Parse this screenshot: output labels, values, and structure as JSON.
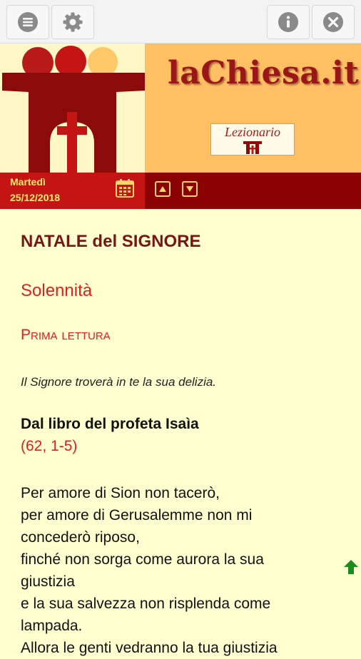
{
  "toolbar": {
    "left_icons": [
      "menu-icon",
      "gear-icon"
    ],
    "right_icons": [
      "info-icon",
      "close-icon"
    ]
  },
  "header": {
    "site_title": "laChiesa.it",
    "badge_label": "Lezionario"
  },
  "datebar": {
    "day_name": "Martedì",
    "date": "25/12/2018"
  },
  "content": {
    "title": "NATALE del SIGNORE",
    "solemnity": "Solennità",
    "reading_label": "Prima lettura",
    "antiphon": "Il Signore troverà in te la sua delizia.",
    "book": "Dal libro del profeta Isaìa",
    "reference": "(62, 1-5)",
    "verses": [
      "Per amore di Sion non tacerò,",
      "per amore di Gerusalemme non mi",
      "concederò riposo,",
      "finché non sorga come aurora la sua",
      "giustizia",
      "e la sua salvezza non risplenda come",
      "lampada.",
      "Allora le genti vedranno la tua giustizia"
    ]
  },
  "colors": {
    "accent_red": "#e02020",
    "dark_red": "#8b0000",
    "brand_orange": "#fec063",
    "page_bg": "#ffffcf"
  }
}
